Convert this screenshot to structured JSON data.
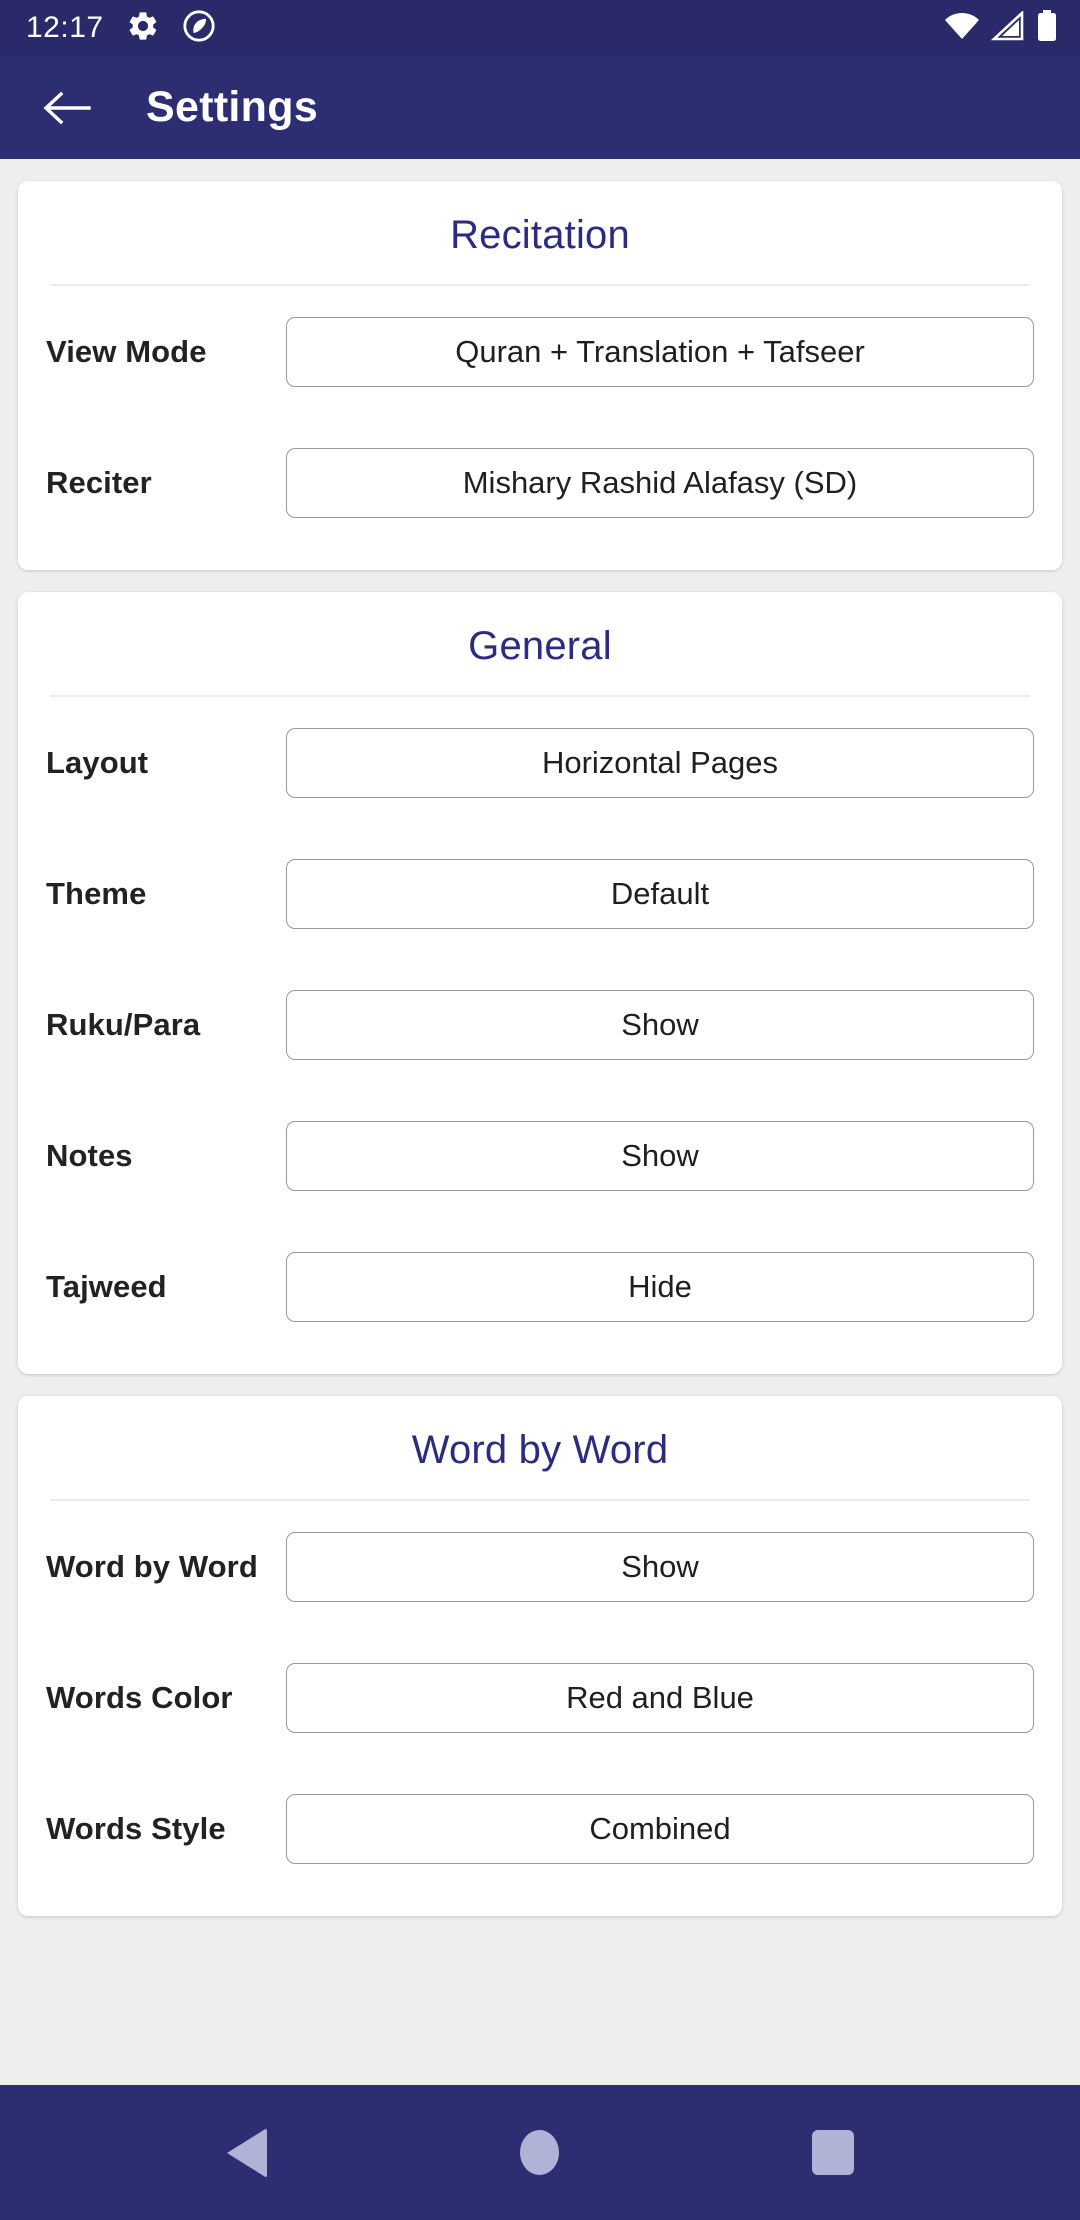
{
  "status_bar": {
    "clock": "12:17",
    "icons": [
      "gear-icon",
      "app-logo-icon",
      "wifi-icon",
      "cellular-signal-icon",
      "battery-icon"
    ]
  },
  "app_bar": {
    "back_label": "back-arrow",
    "title": "Settings"
  },
  "theme": {
    "app_bar_bg": "#2d2d71",
    "status_bar_bg": "#2a2a6b",
    "page_bg": "#eeeeee",
    "card_bg": "#ffffff",
    "section_title_color": "#2b2b82",
    "nav_icon_color": "#b0b2d6"
  },
  "sections": [
    {
      "title": "Recitation",
      "rows": [
        {
          "label": "View Mode",
          "value": "Quran + Translation + Tafseer"
        },
        {
          "label": "Reciter",
          "value": "Mishary Rashid Alafasy (SD)"
        }
      ]
    },
    {
      "title": "General",
      "rows": [
        {
          "label": "Layout",
          "value": "Horizontal Pages"
        },
        {
          "label": "Theme",
          "value": "Default"
        },
        {
          "label": "Ruku/Para",
          "value": "Show"
        },
        {
          "label": "Notes",
          "value": "Show"
        },
        {
          "label": "Tajweed",
          "value": "Hide"
        }
      ]
    },
    {
      "title": "Word by Word",
      "rows": [
        {
          "label": "Word by Word",
          "value": "Show"
        },
        {
          "label": "Words Color",
          "value": "Red and Blue"
        },
        {
          "label": "Words Style",
          "value": "Combined"
        }
      ]
    }
  ],
  "nav_bar": {
    "buttons": [
      "back",
      "home",
      "recents"
    ]
  }
}
